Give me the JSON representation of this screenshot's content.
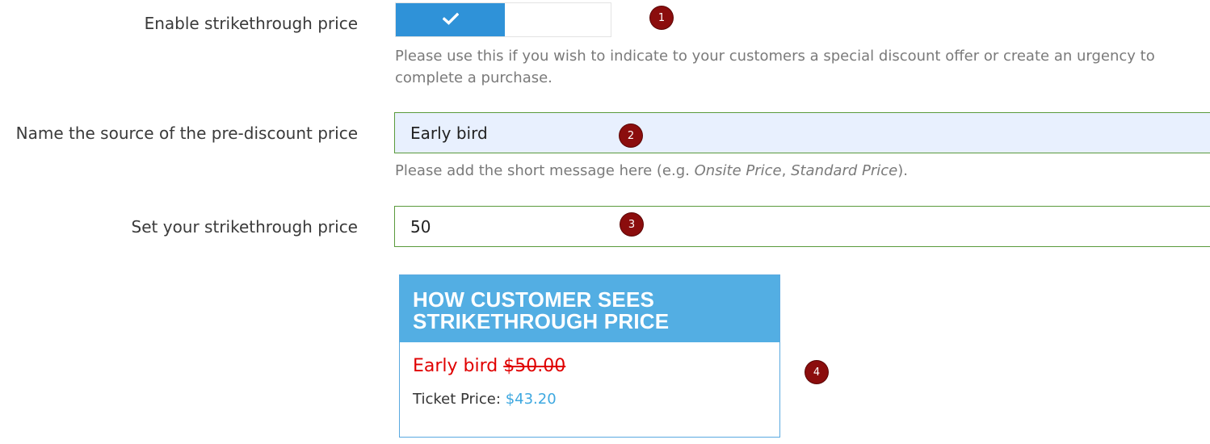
{
  "strikethrough_toggle": {
    "label": "Enable strikethrough price",
    "enabled": true,
    "check_icon": "checkmark-icon",
    "help": "Please use this if you wish to indicate to your customers a special discount offer or create an urgency to complete a purchase."
  },
  "source_name": {
    "label": "Name the source of the pre-discount price",
    "value": "Early bird",
    "help_prefix": "Please add the short message here (e.g. ",
    "help_example_1": "Onsite Price",
    "help_sep": ", ",
    "help_example_2": "Standard Price",
    "help_suffix": ")."
  },
  "strike_price": {
    "label": "Set your strikethrough price",
    "value": "50"
  },
  "preview": {
    "title": "HOW CUSTOMER SEES STRIKETHROUGH PRICE",
    "source_text": "Early bird",
    "original_price": "$50.00",
    "ticket_label": "Ticket Price:",
    "ticket_price": "$43.20"
  },
  "badges": [
    "1",
    "2",
    "3",
    "4"
  ],
  "colors": {
    "toggle_on": "#2f92d8",
    "badge": "#8b0d0d",
    "preview_header": "#53aee3",
    "strike_red": "#e00000",
    "price_blue": "#3ea8e0"
  }
}
